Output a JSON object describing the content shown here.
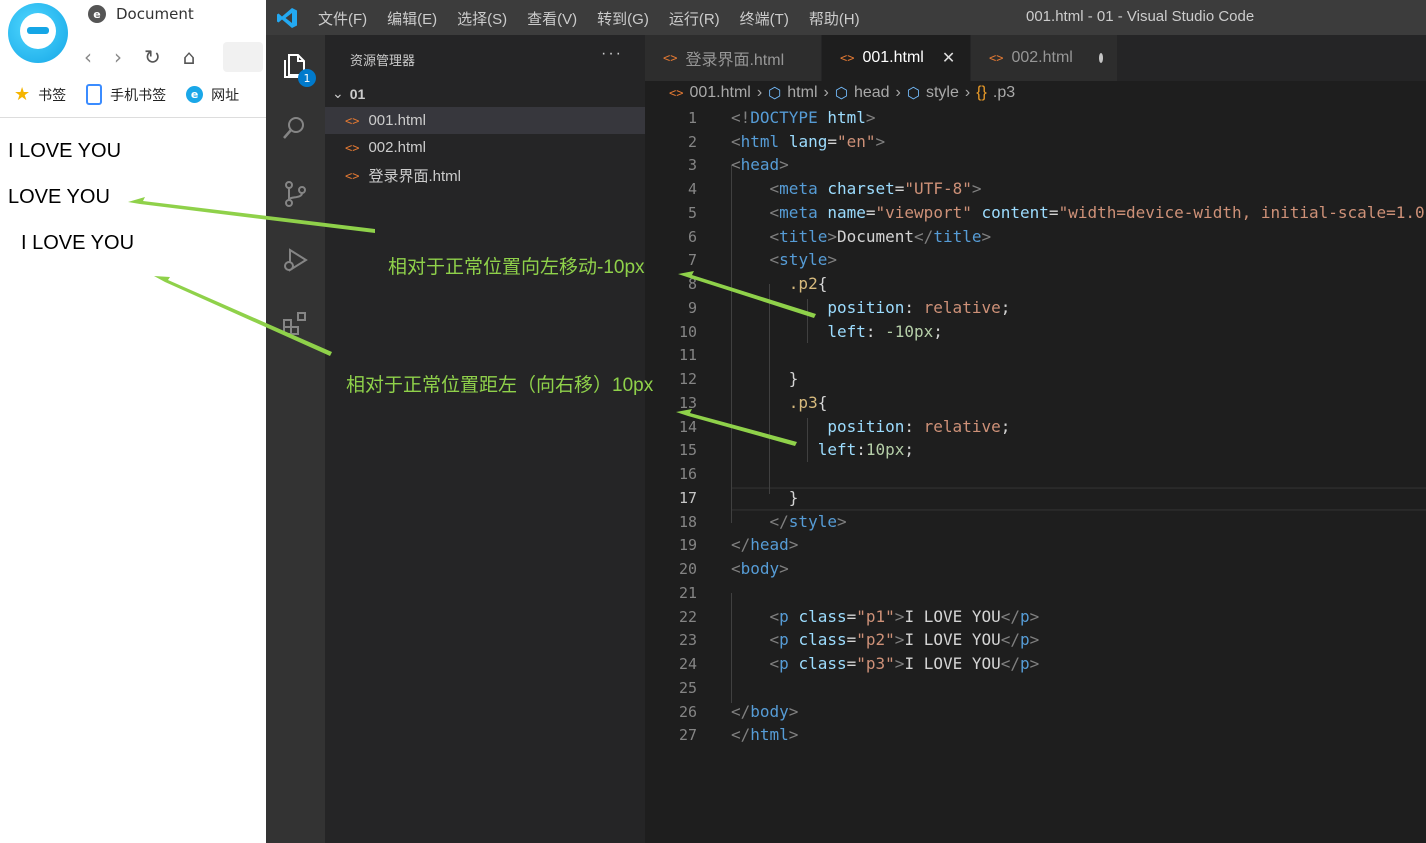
{
  "browser": {
    "tab_title": "Document",
    "bookmarks": [
      {
        "icon": "star-icon",
        "label": "书签"
      },
      {
        "icon": "phone-icon",
        "label": "手机书签"
      },
      {
        "icon": "browser-e-icon",
        "label": "网址"
      }
    ],
    "page_lines": [
      "I LOVE YOU",
      "LOVE YOU",
      "I LOVE YOU"
    ]
  },
  "vscode": {
    "menu": [
      "文件(F)",
      "编辑(E)",
      "选择(S)",
      "查看(V)",
      "转到(G)",
      "运行(R)",
      "终端(T)",
      "帮助(H)"
    ],
    "window_title": "001.html - 01 - Visual Studio Code",
    "explorer": {
      "header": "资源管理器",
      "more": "···",
      "folder": "01",
      "files": [
        "001.html",
        "002.html",
        "登录界面.html"
      ],
      "active_file": "001.html",
      "badge": "1"
    },
    "tabs": [
      {
        "label": "登录界面.html",
        "state": "inactive"
      },
      {
        "label": "001.html",
        "state": "active"
      },
      {
        "label": "002.html",
        "state": "modified"
      }
    ],
    "breadcrumb": [
      "001.html",
      "html",
      "head",
      "style",
      ".p3"
    ],
    "line_numbers": [
      "1",
      "2",
      "3",
      "4",
      "5",
      "6",
      "7",
      "8",
      "9",
      "10",
      "11",
      "12",
      "13",
      "14",
      "15",
      "16",
      "17",
      "18",
      "19",
      "20",
      "21",
      "22",
      "23",
      "24",
      "25",
      "26",
      "27"
    ],
    "current_line": "17",
    "accent": "#007acc"
  },
  "annotations": [
    "相对于正常位置向左移动-10px",
    "相对于正常位置距左（向右移）10px"
  ],
  "annotation_color": "#8fd14a"
}
